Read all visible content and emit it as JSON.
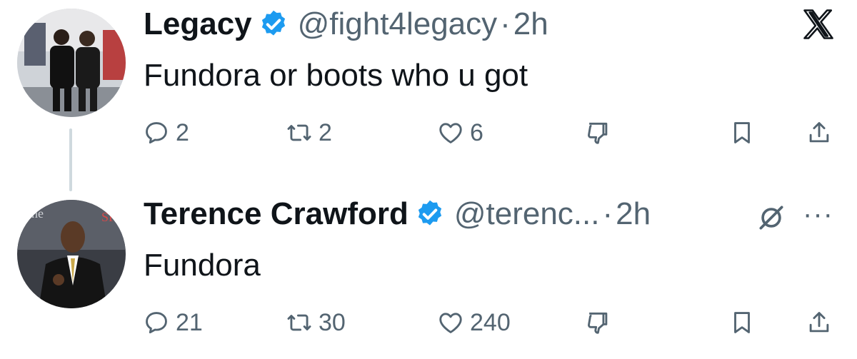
{
  "tweets": [
    {
      "display_name": "Legacy",
      "handle": "@fight4legacy",
      "separator": "·",
      "time": "2h",
      "text": "Fundora or boots who u got",
      "replies": "2",
      "retweets": "2",
      "likes": "6",
      "avatar": "avatar-two-people-in-hallway"
    },
    {
      "display_name": "Terence Crawford",
      "handle": "@terenc...",
      "separator": "·",
      "time": "2h",
      "text": "Fundora",
      "replies": "21",
      "retweets": "30",
      "likes": "240",
      "avatar": "avatar-man-in-suit"
    }
  ],
  "icons": {
    "app_logo": "x-logo-icon",
    "verified": "verified-badge-icon",
    "grok": "grok-icon",
    "more": "more-icon",
    "reply": "reply-icon",
    "retweet": "retweet-icon",
    "like": "heart-icon",
    "dislike": "thumbs-down-icon",
    "bookmark": "bookmark-icon",
    "share": "share-icon"
  },
  "more_glyph": "···",
  "colors": {
    "text": "#0f1419",
    "secondary": "#536471",
    "verified": "#1d9bf0",
    "thread_line": "#cfd9de"
  }
}
